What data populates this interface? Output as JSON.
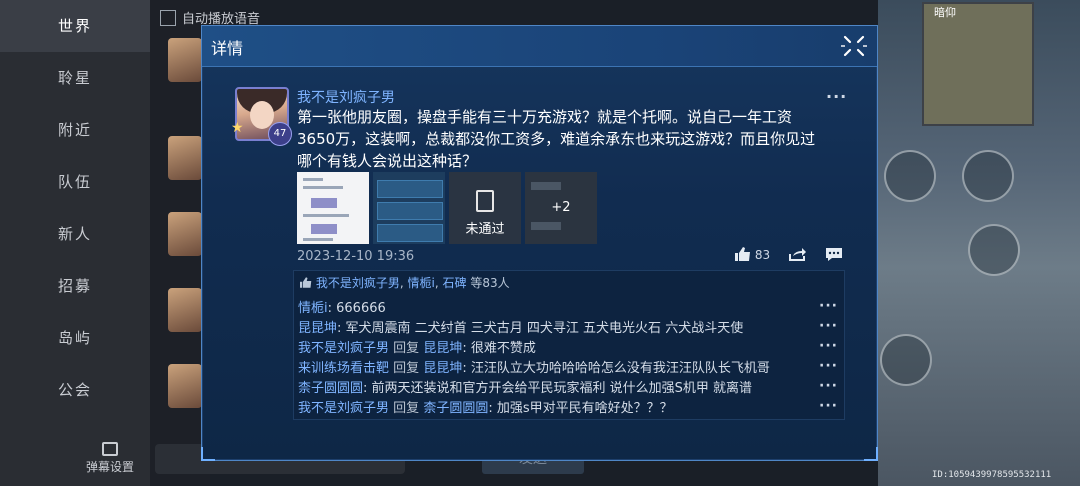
{
  "background": {
    "autoplay_label": "自动播放语音",
    "nav_items": [
      "世界",
      "聆星",
      "附近",
      "队伍",
      "新人",
      "招募",
      "岛屿",
      "公会"
    ],
    "danmu_label": "弹幕设置",
    "send_label": "发送",
    "map_label": "暗仰",
    "id_text": "ID:1059439978595532111"
  },
  "dialog": {
    "title": "详情"
  },
  "post": {
    "author_name": "我不是刘疯子男",
    "level": "47",
    "text": "第一张他朋友圈，操盘手能有三十万充游戏？就是个托啊。说自己一年工资3650万，这装啊，总裁都没你工资多，难道余承东也来玩这游戏？而且你见过哪个有钱人会说出这种话？",
    "images": {
      "rejected_label": "未通过",
      "more_count": "+2"
    },
    "time": "2023-12-10 19:36",
    "likes": "83"
  },
  "likers": {
    "names": [
      "我不是刘疯子男",
      "情栀i",
      "石碑"
    ],
    "suffix": "等83人"
  },
  "comments": [
    {
      "author": "情栀i",
      "reply_to": "",
      "text": ": 666666"
    },
    {
      "author": "昆昆坤",
      "reply_to": "",
      "text": ": 军犬周震南 二犬纣首 三犬古月 四犬寻江 五犬电光火石 六犬战斗天使"
    },
    {
      "author": "我不是刘疯子男",
      "reply_to": "昆昆坤",
      "text": ": 很难不赞成"
    },
    {
      "author": "来训练场看击靶",
      "reply_to": "昆昆坤",
      "text": ": 汪汪队立大功哈哈哈哈怎么没有我汪汪队队长飞机哥"
    },
    {
      "author": "柰子圆圆圆",
      "reply_to": "",
      "text": ": 前两天还装说和官方开会给平民玩家福利 说什么加强S机甲 就离谱"
    },
    {
      "author": "我不是刘疯子男",
      "reply_to": "柰子圆圆圆",
      "text": ": 加强s甲对平民有啥好处？？？"
    }
  ],
  "reply_word": "回复"
}
